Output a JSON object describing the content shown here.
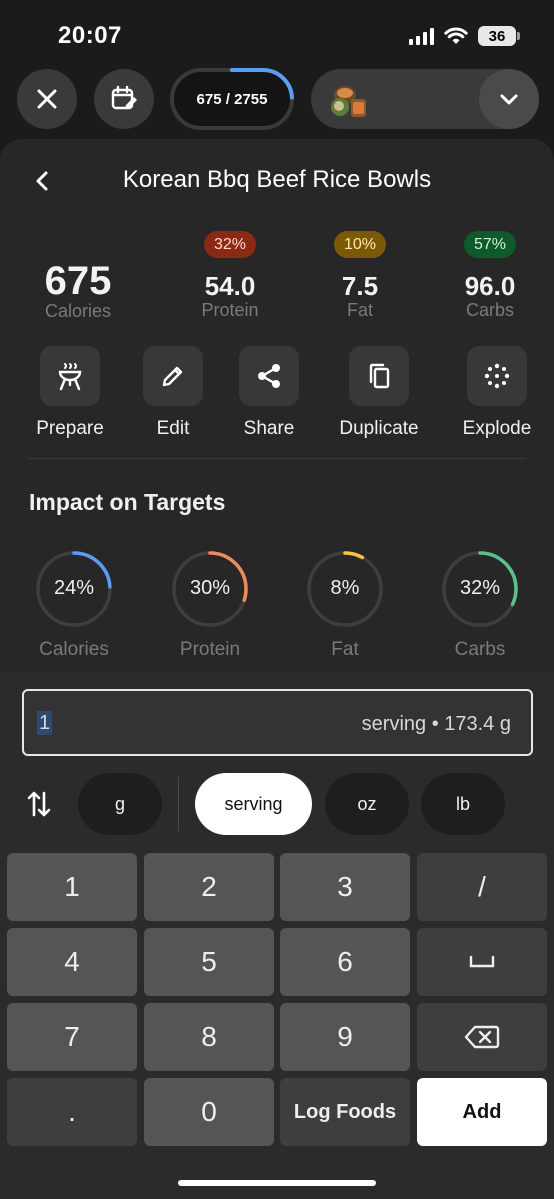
{
  "status_bar": {
    "time": "20:07",
    "battery": "36"
  },
  "toolbar": {
    "progress_text": "675 / 2755",
    "progress_fraction": 0.245
  },
  "meal": {
    "title": "Korean Bbq Beef Rice Bowls",
    "calories": {
      "value": "675",
      "label": "Calories"
    },
    "macros": [
      {
        "badge": "32%",
        "value": "54.0",
        "label": "Protein",
        "badge_color": "#8a2a14"
      },
      {
        "badge": "10%",
        "value": "7.5",
        "label": "Fat",
        "badge_color": "#7a5a05"
      },
      {
        "badge": "57%",
        "value": "96.0",
        "label": "Carbs",
        "badge_color": "#0f5a2a"
      }
    ]
  },
  "actions": [
    {
      "label": "Prepare",
      "icon": "grill-icon"
    },
    {
      "label": "Edit",
      "icon": "pencil-icon"
    },
    {
      "label": "Share",
      "icon": "share-icon"
    },
    {
      "label": "Duplicate",
      "icon": "copy-icon"
    },
    {
      "label": "Explode",
      "icon": "explode-icon"
    }
  ],
  "impact": {
    "title": "Impact on Targets",
    "rings": [
      {
        "pct": "24%",
        "label": "Calories",
        "fraction": 0.24,
        "color": "#5b9cf5"
      },
      {
        "pct": "30%",
        "label": "Protein",
        "fraction": 0.3,
        "color": "#f08a5d"
      },
      {
        "pct": "8%",
        "label": "Fat",
        "fraction": 0.08,
        "color": "#f5c542"
      },
      {
        "pct": "32%",
        "label": "Carbs",
        "fraction": 0.32,
        "color": "#5cc08a"
      }
    ]
  },
  "quantity": {
    "value": "1",
    "unit_text": "serving • 173.4 g"
  },
  "units": [
    {
      "label": "g",
      "active": false
    },
    {
      "label": "serving",
      "active": true
    },
    {
      "label": "oz",
      "active": false
    },
    {
      "label": "lb",
      "active": false
    }
  ],
  "keypad": {
    "k1": "1",
    "k2": "2",
    "k3": "3",
    "slash": "/",
    "k4": "4",
    "k5": "5",
    "k6": "6",
    "space": "␣",
    "k7": "7",
    "k8": "8",
    "k9": "9",
    "dot": ".",
    "k0": "0",
    "log_foods": "Log Foods",
    "add": "Add"
  }
}
